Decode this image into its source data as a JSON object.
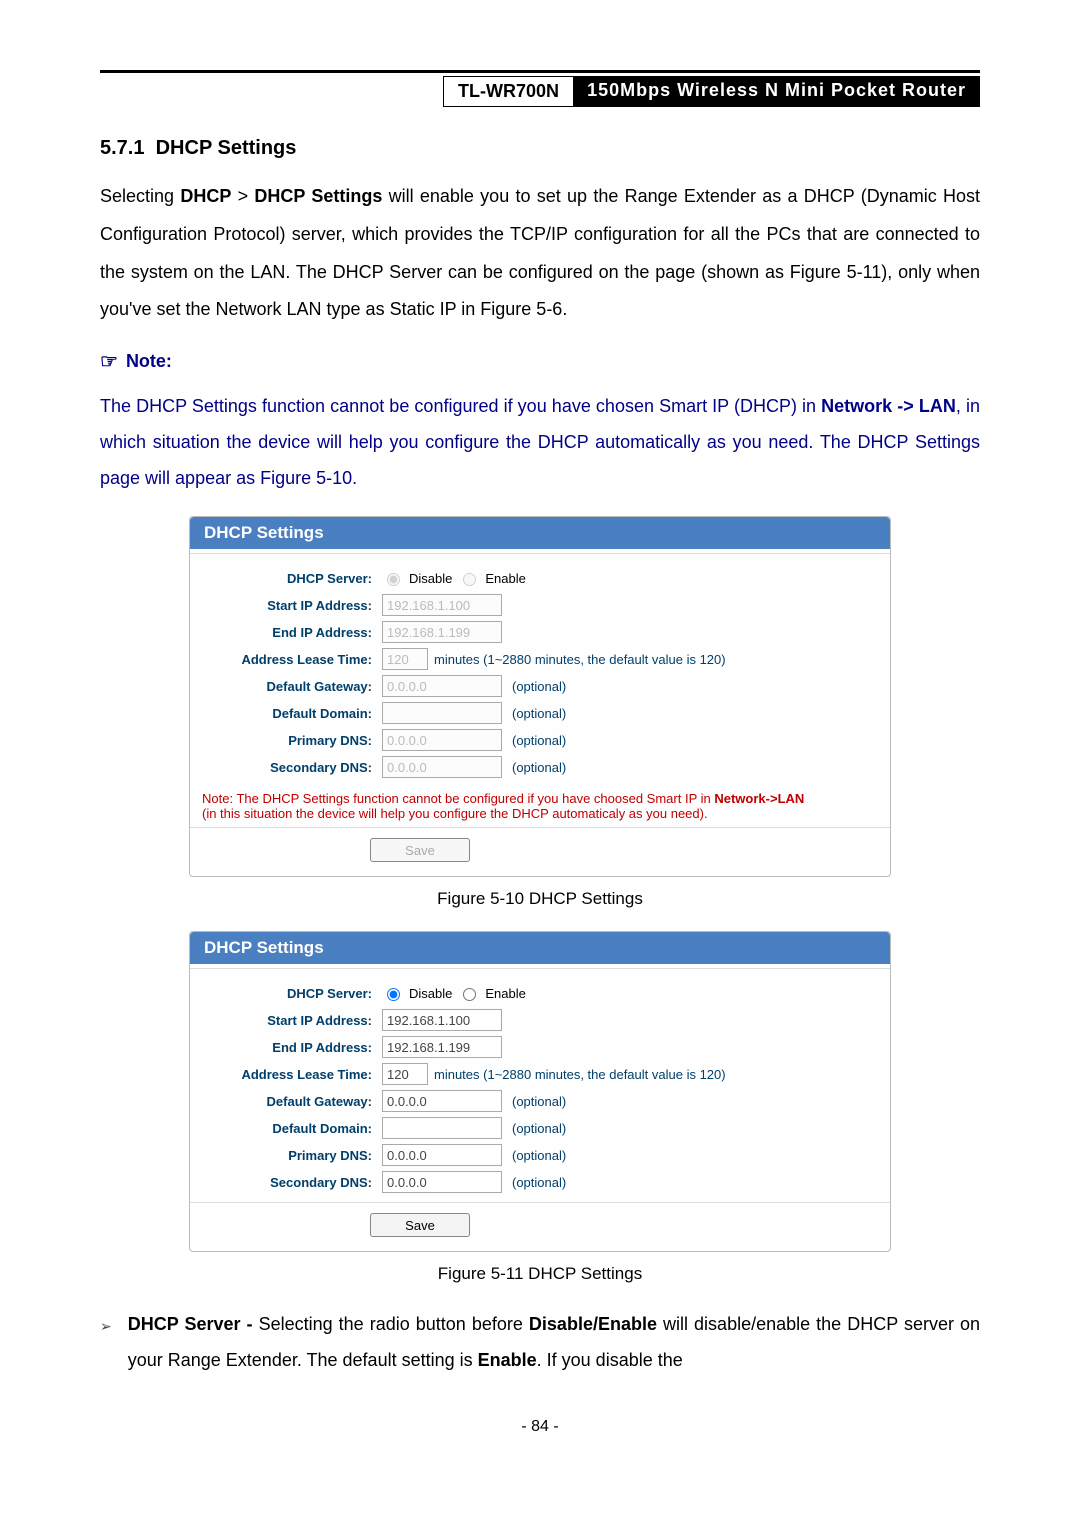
{
  "header": {
    "model": "TL-WR700N",
    "desc": "150Mbps Wireless N Mini Pocket Router"
  },
  "section": {
    "number": "5.7.1",
    "title": "DHCP Settings"
  },
  "para1_prefix": "Selecting ",
  "para1_b1": "DHCP",
  "para1_gt": " > ",
  "para1_b2": "DHCP Settings",
  "para1_rest": " will enable you to set up the Range Extender as a DHCP (Dynamic Host Configuration Protocol) server, which provides the TCP/IP configuration for all the PCs that are connected to the system on the LAN. The DHCP Server can be configured on the page (shown as Figure 5-11), only when you've set the Network LAN type as Static IP in Figure 5-6.",
  "note_label": "Note:",
  "note_p1": "The DHCP Settings function cannot be configured if you have chosen Smart IP (DHCP) in ",
  "note_b1": "Network -> LAN",
  "note_p2": ", in which situation the device will help you configure the DHCP automatically as you need. The DHCP Settings page will appear as Figure 5-10.",
  "panel": {
    "title": "DHCP Settings",
    "labels": {
      "server": "DHCP Server:",
      "start": "Start IP Address:",
      "end": "End IP Address:",
      "lease": "Address Lease Time:",
      "gateway": "Default Gateway:",
      "domain": "Default Domain:",
      "pdns": "Primary DNS:",
      "sdns": "Secondary DNS:"
    },
    "radio": {
      "disable": "Disable",
      "enable": "Enable"
    },
    "values": {
      "start": "192.168.1.100",
      "end": "192.168.1.199",
      "lease": "120",
      "gateway": "0.0.0.0",
      "domain": "",
      "pdns": "0.0.0.0",
      "sdns": "0.0.0.0"
    },
    "lease_hint": "minutes (1~2880 minutes, the default value is 120)",
    "optional": "(optional)",
    "warn1a": "Note: The DHCP Settings function cannot be configured if you have choosed Smart IP in ",
    "warn1b": "Network->LAN",
    "warn2": "(in this situation the device will help you configure the DHCP automaticaly as you need).",
    "save": "Save"
  },
  "fig10": "Figure 5-10 DHCP Settings",
  "fig11": "Figure 5-11 DHCP Settings",
  "bullet": {
    "b1": "DHCP Server - ",
    "t1": "Selecting the radio button before ",
    "b2": "Disable/Enable",
    "t2": " will disable/enable the DHCP server on your Range Extender. The default setting is ",
    "b3": "Enable",
    "t3": ". If you disable the"
  },
  "page_num": "- 84 -"
}
